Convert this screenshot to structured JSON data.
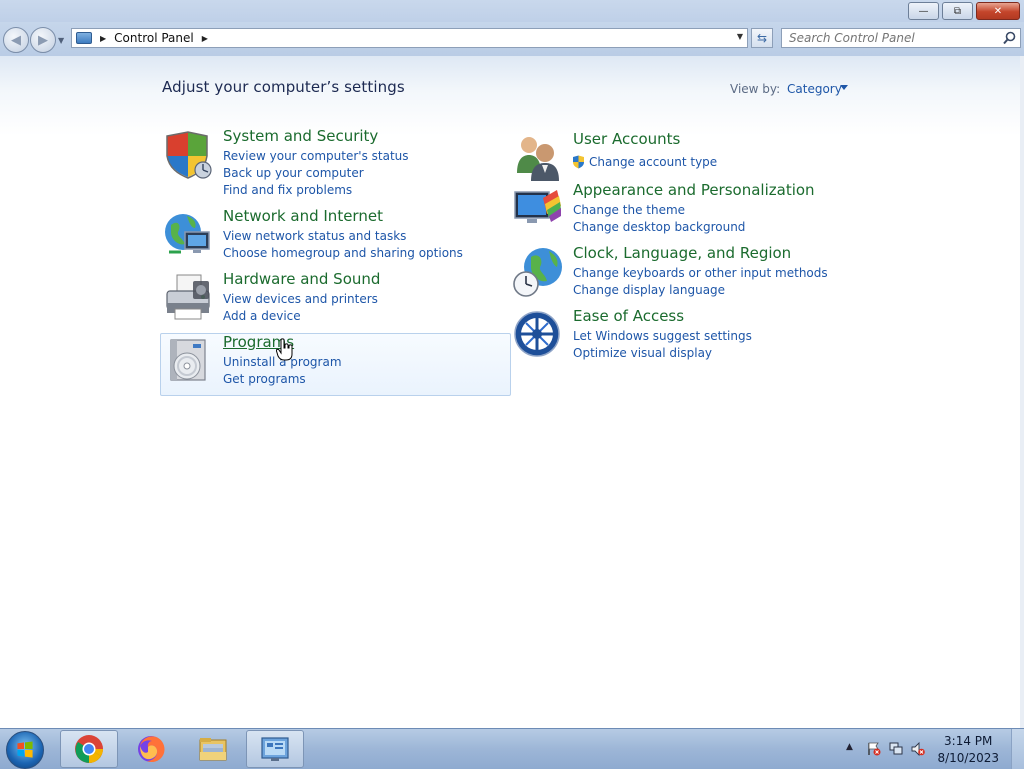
{
  "window": {
    "caption_buttons": [
      "minimize-icon",
      "restore-icon",
      "close-icon"
    ]
  },
  "navigation": {
    "back_icon": "back-arrow-icon",
    "forward_icon": "forward-arrow-icon",
    "breadcrumb": [
      "Control Panel"
    ],
    "search_placeholder": "Search Control Panel"
  },
  "header": {
    "title": "Adjust your computer’s settings",
    "view_by_label": "View by:",
    "view_by_value": "Category"
  },
  "categories_left": [
    {
      "title": "System and Security",
      "icon": "shield-icon",
      "links": [
        "Review your computer's status",
        "Back up your computer",
        "Find and fix problems"
      ]
    },
    {
      "title": "Network and Internet",
      "icon": "network-globe-icon",
      "links": [
        "View network status and tasks",
        "Choose homegroup and sharing options"
      ]
    },
    {
      "title": "Hardware and Sound",
      "icon": "printer-icon",
      "links": [
        "View devices and printers",
        "Add a device"
      ]
    },
    {
      "title": "Programs",
      "icon": "programs-disc-icon",
      "links": [
        "Uninstall a program",
        "Get programs"
      ]
    }
  ],
  "categories_right": [
    {
      "title": "User Accounts",
      "icon": "users-icon",
      "links": [
        "Change account type"
      ]
    },
    {
      "title": "Appearance and Personalization",
      "icon": "monitor-palette-icon",
      "links": [
        "Change the theme",
        "Change desktop background"
      ]
    },
    {
      "title": "Clock, Language, and Region",
      "icon": "globe-clock-icon",
      "links": [
        "Change keyboards or other input methods",
        "Change display language"
      ]
    },
    {
      "title": "Ease of Access",
      "icon": "ease-of-access-icon",
      "links": [
        "Let Windows suggest settings",
        "Optimize visual display"
      ]
    }
  ],
  "taskbar": {
    "pinned": [
      "chrome-icon",
      "firefox-icon",
      "file-explorer-icon",
      "control-panel-icon"
    ],
    "clock_time": "3:14 PM",
    "clock_date": "8/10/2023"
  },
  "colors": {
    "category_title": "#1b6b2e",
    "link": "#1e56a8",
    "hover_border": "#b9d1ec"
  }
}
